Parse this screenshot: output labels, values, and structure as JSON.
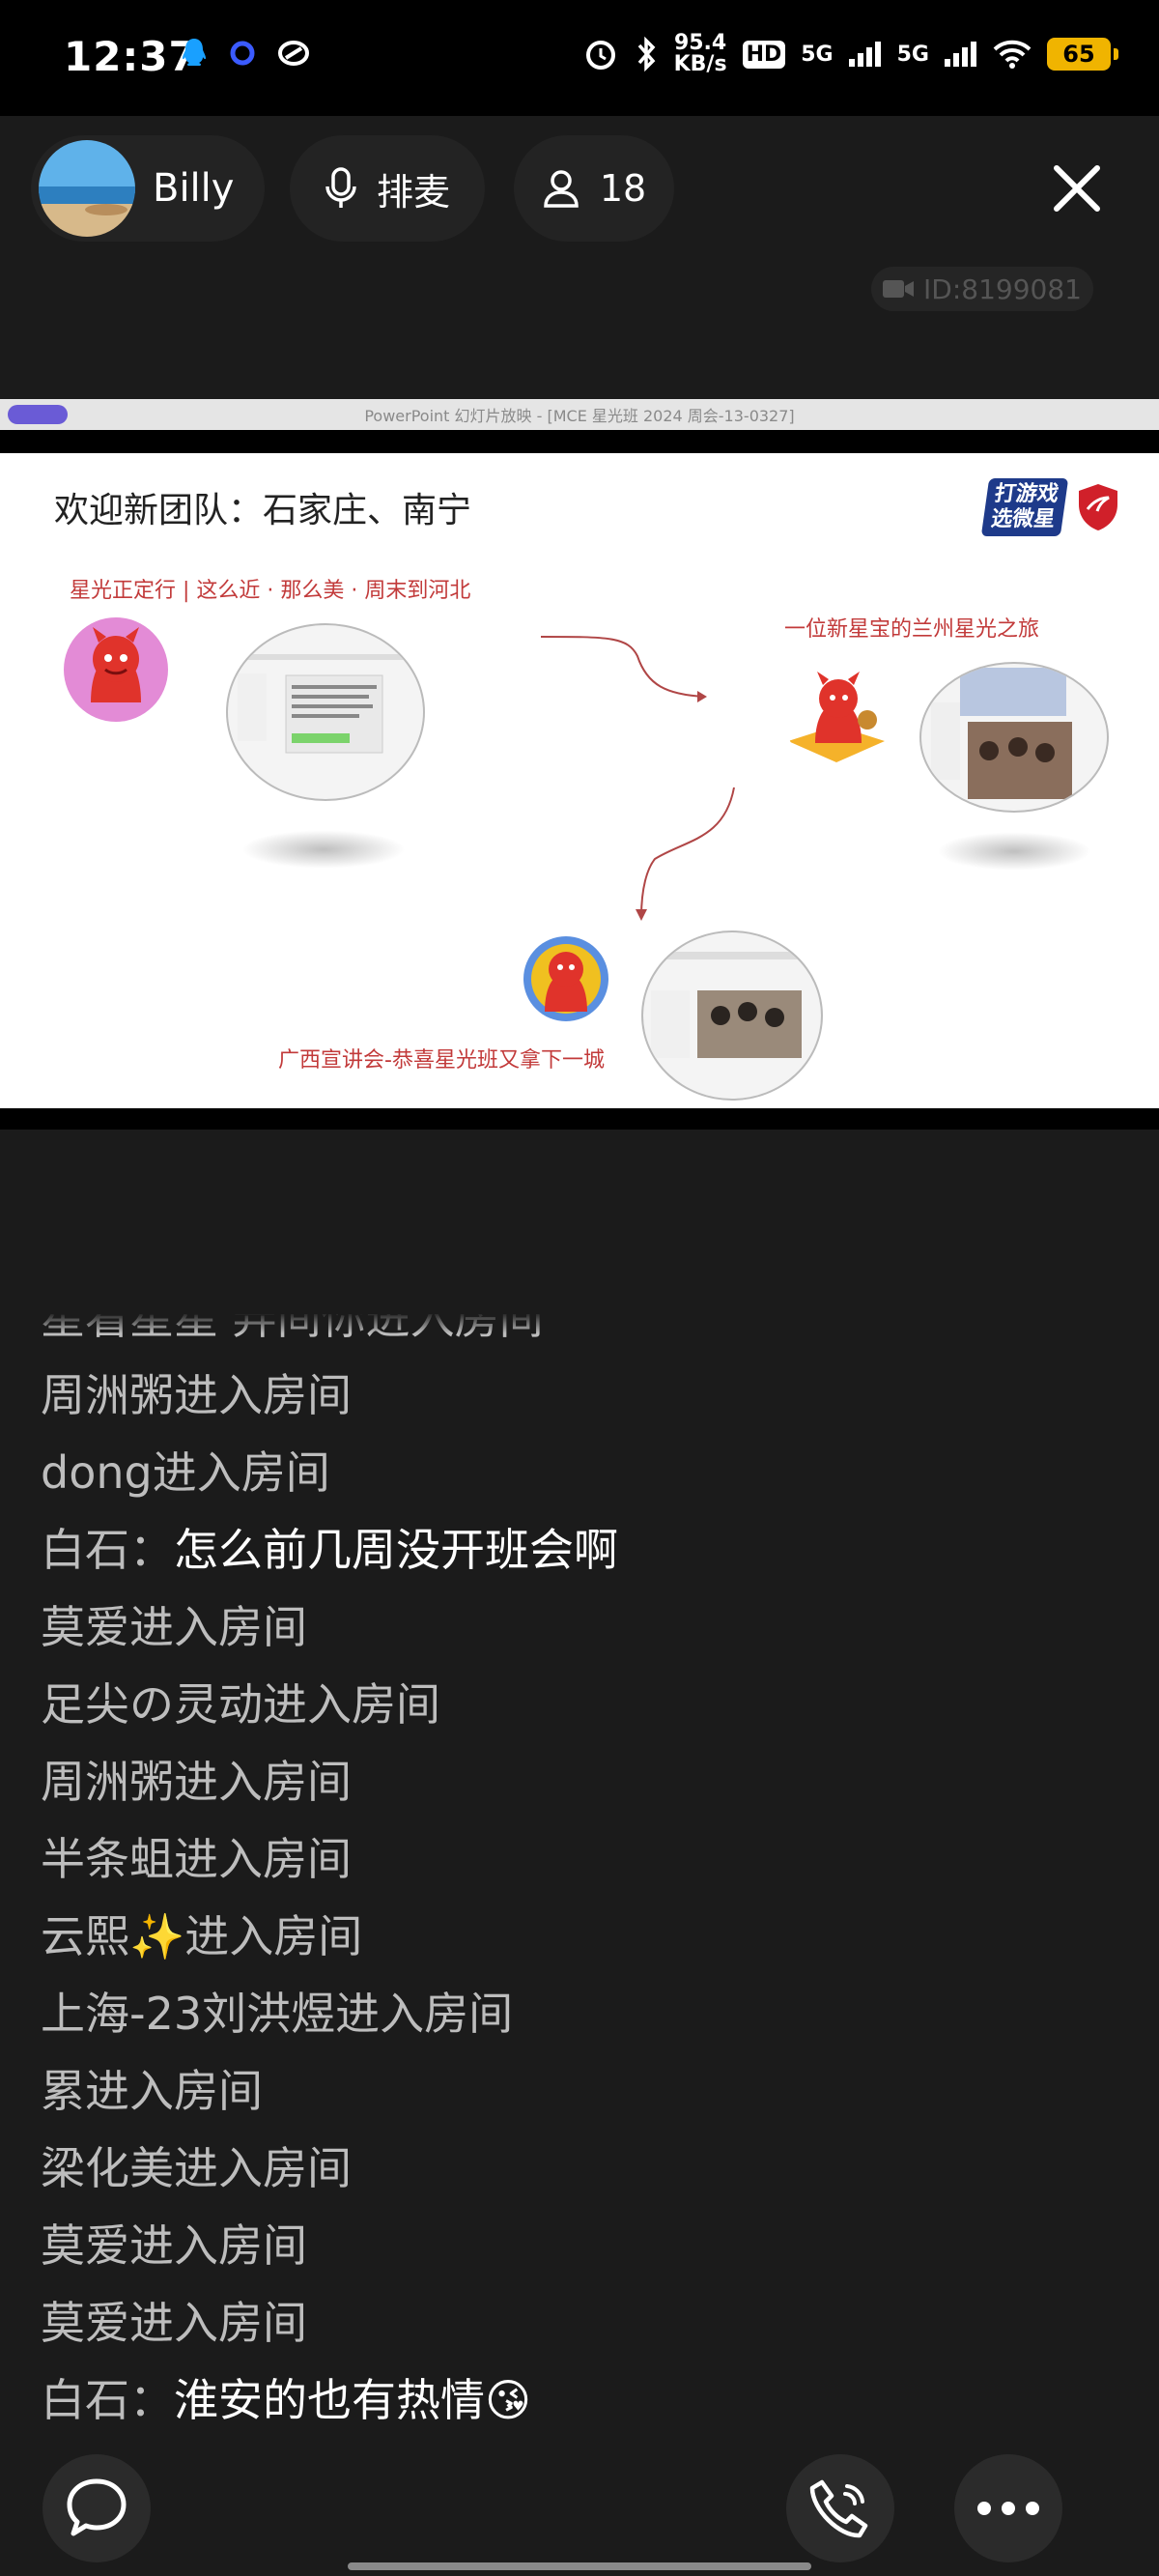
{
  "status_bar": {
    "time": "12:37",
    "net_speed_value": "95.4",
    "net_speed_unit": "KB/s",
    "hd_label": "HD",
    "signal1": "5G",
    "signal2": "5G",
    "battery": "65"
  },
  "header": {
    "user_name": "Billy",
    "mic_label": "排麦",
    "audience_count": "18",
    "room_id": "ID:8199081"
  },
  "ppt": {
    "window_title": "PowerPoint 幻灯片放映 - [MCE 星光班 2024 周会-13-0327]",
    "slide_title": "欢迎新团队：石家庄、南宁",
    "logo_line1": "打游戏",
    "logo_line2": "选微星",
    "caption_1": "星光正定行 | 这么近 · 那么美 · 周末到河北",
    "caption_2": "一位新星宝的兰州星光之旅",
    "caption_3": "广西宣讲会-恭喜星光班又拿下一城"
  },
  "chat": {
    "partial_top": "星看星星 弄间你进入房间",
    "lines": [
      {
        "speaker": "周洲粥进入房间",
        "text": ""
      },
      {
        "speaker": "dong进入房间",
        "text": ""
      },
      {
        "speaker": "白石：",
        "text": "怎么前几周没开班会啊"
      },
      {
        "speaker": "莫爱进入房间",
        "text": ""
      },
      {
        "speaker": "足尖の灵动进入房间",
        "text": ""
      },
      {
        "speaker": "周洲粥进入房间",
        "text": ""
      },
      {
        "speaker": "半条蛆进入房间",
        "text": ""
      },
      {
        "speaker": "云熙✨进入房间",
        "text": ""
      },
      {
        "speaker": "上海-23刘洪煜进入房间",
        "text": ""
      },
      {
        "speaker": "累进入房间",
        "text": ""
      },
      {
        "speaker": "梁化美进入房间",
        "text": ""
      },
      {
        "speaker": "莫爱进入房间",
        "text": ""
      },
      {
        "speaker": "莫爱进入房间",
        "text": ""
      },
      {
        "speaker": "白石：",
        "text": "淮安的也有热情😘"
      }
    ]
  },
  "icons": {
    "chat": "chat-bubble-icon",
    "call": "phone-icon",
    "more": "more-dots-icon",
    "close": "close-icon",
    "mic": "mic-icon",
    "people": "person-icon"
  }
}
